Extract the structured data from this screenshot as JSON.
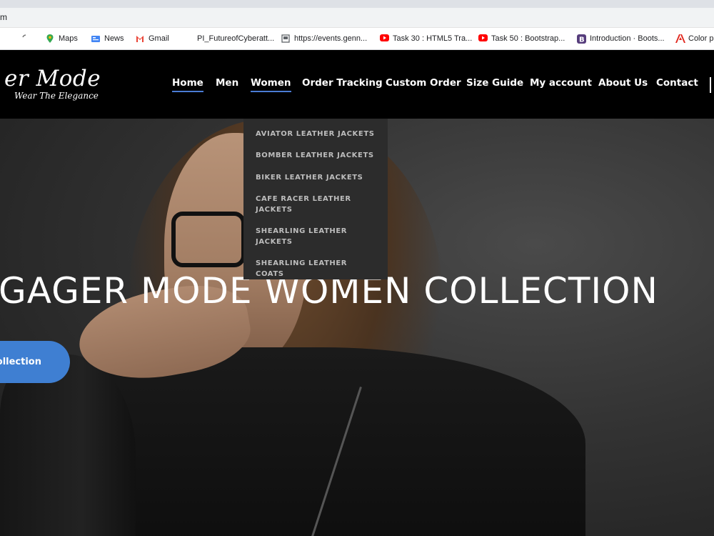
{
  "browser": {
    "url_fragment": "m",
    "bookmarks": [
      {
        "label": "",
        "icon": "loading-icon"
      },
      {
        "label": "Maps",
        "icon": "maps-icon"
      },
      {
        "label": "News",
        "icon": "news-icon"
      },
      {
        "label": "Gmail",
        "icon": "gmail-icon"
      },
      {
        "label": "PI_FutureofCyberatt...",
        "icon": ""
      },
      {
        "label": "https://events.genn...",
        "icon": "page-icon"
      },
      {
        "label": "Task 30 : HTML5 Tra...",
        "icon": "youtube-icon"
      },
      {
        "label": "Task 50 : Bootstrap...",
        "icon": "youtube-icon"
      },
      {
        "label": "Introduction · Boots...",
        "icon": "bootstrap-icon"
      },
      {
        "label": "Color p",
        "icon": "adobe-icon"
      }
    ]
  },
  "site": {
    "logo_text": "er Mode",
    "logo_tagline": "Wear The Elegance",
    "nav": [
      "Home",
      "Men",
      "Women",
      "Order Tracking",
      "Custom Order",
      "Size Guide",
      "My account",
      "About Us",
      "Contact"
    ],
    "dropdown": [
      "AVIATOR LEATHER JACKETS",
      "BOMBER LEATHER JACKETS",
      "BIKER LEATHER JACKETS",
      "CAFE RACER LEATHER JACKETS",
      "SHEARLING LEATHER JACKETS",
      "SHEARLING LEATHER COATS"
    ],
    "hero_title": "GAGER MODE WOMEN COLLECTION",
    "hero_button": "ollection"
  },
  "colors": {
    "accent": "#3f7fd2",
    "nav_underline": "#4a7bd4",
    "header_bg": "#000000",
    "dropdown_bg": "#2c2c2c"
  }
}
